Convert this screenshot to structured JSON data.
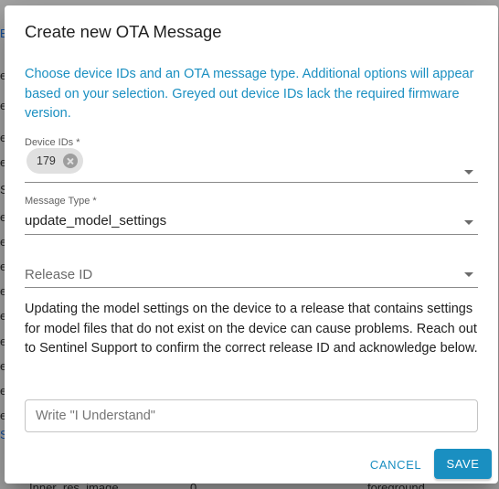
{
  "background": {
    "fragments": [
      "B",
      "e",
      "e",
      "e",
      "e",
      "S",
      "e",
      "e",
      "e",
      "e",
      "e",
      "e",
      "e",
      "e",
      "e",
      "S"
    ],
    "bottom_row": [
      "Inner_res_image",
      "0",
      "foreground"
    ]
  },
  "dialog": {
    "title": "Create new OTA Message",
    "intro": "Choose device IDs and an OTA message type. Additional options will appear based on your selection. Greyed out device IDs lack the required firmware version.",
    "device_ids": {
      "label": "Device IDs *",
      "selected": [
        "179"
      ]
    },
    "message_type": {
      "label": "Message Type *",
      "value": "update_model_settings"
    },
    "release_id": {
      "placeholder": "Release ID"
    },
    "warning": "Updating the model settings on the device to a release that contains settings for model files that do not exist on the device can cause problems. Reach out to Sentinel Support to confirm the correct release ID and acknowledge below.",
    "confirm_input": {
      "placeholder": "Write \"I Understand\"",
      "value": ""
    },
    "actions": {
      "cancel_label": "CANCEL",
      "save_label": "SAVE"
    }
  },
  "colors": {
    "accent": "#1a8fc1",
    "scrim": "rgba(0,0,0,0.32)"
  }
}
